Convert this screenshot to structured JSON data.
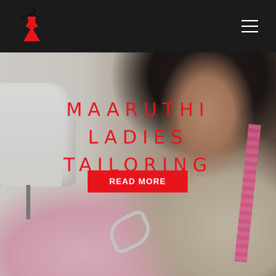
{
  "header": {
    "logo_icon": "dress-hanger-icon",
    "menu_icon": "hamburger-menu-icon",
    "brand_color": "#e8141c"
  },
  "hero": {
    "title": "MAARUTHI LADIES TAILORING",
    "cta_label": "READ MORE",
    "accent_color": "#e8141c"
  }
}
